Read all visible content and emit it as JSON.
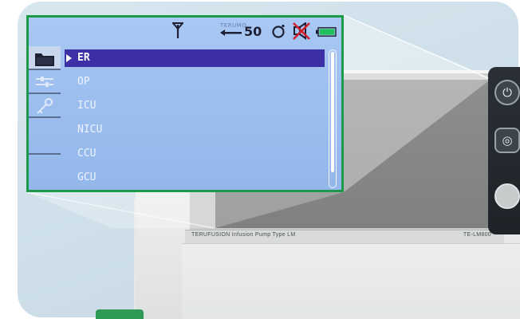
{
  "colors": {
    "lcd_background": "#9ec0f0",
    "selection_highlight": "#3d2fa5",
    "frame_border": "#1c9a4a",
    "battery_fill": "#22c05c",
    "alarm_cross": "#d0202a"
  },
  "status_bar": {
    "flow_label": "TERUMO",
    "flow_value": "50",
    "icons": [
      "antenna-icon",
      "pressure-icon",
      "alarm-off-icon",
      "battery-icon"
    ],
    "battery_level": 1.0
  },
  "side_icons": [
    "folder-icon",
    "adjust-icon",
    "key-icon"
  ],
  "ward_list": {
    "items": [
      {
        "label": "ER",
        "selected": true
      },
      {
        "label": "OP",
        "selected": false
      },
      {
        "label": "ICU",
        "selected": false
      },
      {
        "label": "NICU",
        "selected": false
      },
      {
        "label": "CCU",
        "selected": false
      },
      {
        "label": "GCU",
        "selected": false
      }
    ],
    "scroll_fraction_visible": 0.9,
    "scroll_position": 0.0
  },
  "device": {
    "brand_text": "TERUFUSION Infusion Pump Type LM",
    "model_text": "TE-LM800",
    "side_buttons": [
      "power-icon",
      "menu-icon",
      "round-button"
    ]
  }
}
